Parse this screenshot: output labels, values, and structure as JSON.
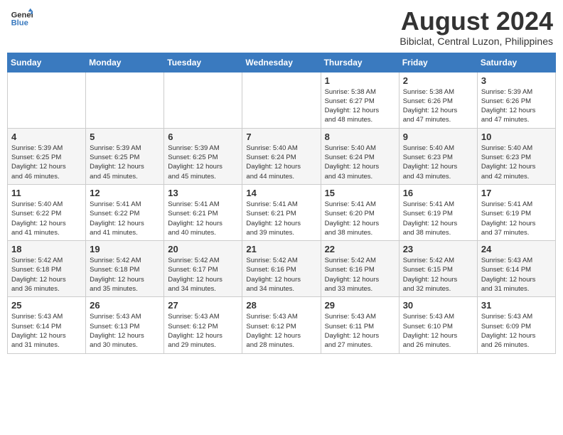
{
  "logo": {
    "line1": "General",
    "line2": "Blue"
  },
  "title": "August 2024",
  "location": "Bibiclat, Central Luzon, Philippines",
  "weekdays": [
    "Sunday",
    "Monday",
    "Tuesday",
    "Wednesday",
    "Thursday",
    "Friday",
    "Saturday"
  ],
  "weeks": [
    [
      {
        "day": "",
        "info": ""
      },
      {
        "day": "",
        "info": ""
      },
      {
        "day": "",
        "info": ""
      },
      {
        "day": "",
        "info": ""
      },
      {
        "day": "1",
        "info": "Sunrise: 5:38 AM\nSunset: 6:27 PM\nDaylight: 12 hours\nand 48 minutes."
      },
      {
        "day": "2",
        "info": "Sunrise: 5:38 AM\nSunset: 6:26 PM\nDaylight: 12 hours\nand 47 minutes."
      },
      {
        "day": "3",
        "info": "Sunrise: 5:39 AM\nSunset: 6:26 PM\nDaylight: 12 hours\nand 47 minutes."
      }
    ],
    [
      {
        "day": "4",
        "info": "Sunrise: 5:39 AM\nSunset: 6:25 PM\nDaylight: 12 hours\nand 46 minutes."
      },
      {
        "day": "5",
        "info": "Sunrise: 5:39 AM\nSunset: 6:25 PM\nDaylight: 12 hours\nand 45 minutes."
      },
      {
        "day": "6",
        "info": "Sunrise: 5:39 AM\nSunset: 6:25 PM\nDaylight: 12 hours\nand 45 minutes."
      },
      {
        "day": "7",
        "info": "Sunrise: 5:40 AM\nSunset: 6:24 PM\nDaylight: 12 hours\nand 44 minutes."
      },
      {
        "day": "8",
        "info": "Sunrise: 5:40 AM\nSunset: 6:24 PM\nDaylight: 12 hours\nand 43 minutes."
      },
      {
        "day": "9",
        "info": "Sunrise: 5:40 AM\nSunset: 6:23 PM\nDaylight: 12 hours\nand 43 minutes."
      },
      {
        "day": "10",
        "info": "Sunrise: 5:40 AM\nSunset: 6:23 PM\nDaylight: 12 hours\nand 42 minutes."
      }
    ],
    [
      {
        "day": "11",
        "info": "Sunrise: 5:40 AM\nSunset: 6:22 PM\nDaylight: 12 hours\nand 41 minutes."
      },
      {
        "day": "12",
        "info": "Sunrise: 5:41 AM\nSunset: 6:22 PM\nDaylight: 12 hours\nand 41 minutes."
      },
      {
        "day": "13",
        "info": "Sunrise: 5:41 AM\nSunset: 6:21 PM\nDaylight: 12 hours\nand 40 minutes."
      },
      {
        "day": "14",
        "info": "Sunrise: 5:41 AM\nSunset: 6:21 PM\nDaylight: 12 hours\nand 39 minutes."
      },
      {
        "day": "15",
        "info": "Sunrise: 5:41 AM\nSunset: 6:20 PM\nDaylight: 12 hours\nand 38 minutes."
      },
      {
        "day": "16",
        "info": "Sunrise: 5:41 AM\nSunset: 6:19 PM\nDaylight: 12 hours\nand 38 minutes."
      },
      {
        "day": "17",
        "info": "Sunrise: 5:41 AM\nSunset: 6:19 PM\nDaylight: 12 hours\nand 37 minutes."
      }
    ],
    [
      {
        "day": "18",
        "info": "Sunrise: 5:42 AM\nSunset: 6:18 PM\nDaylight: 12 hours\nand 36 minutes."
      },
      {
        "day": "19",
        "info": "Sunrise: 5:42 AM\nSunset: 6:18 PM\nDaylight: 12 hours\nand 35 minutes."
      },
      {
        "day": "20",
        "info": "Sunrise: 5:42 AM\nSunset: 6:17 PM\nDaylight: 12 hours\nand 34 minutes."
      },
      {
        "day": "21",
        "info": "Sunrise: 5:42 AM\nSunset: 6:16 PM\nDaylight: 12 hours\nand 34 minutes."
      },
      {
        "day": "22",
        "info": "Sunrise: 5:42 AM\nSunset: 6:16 PM\nDaylight: 12 hours\nand 33 minutes."
      },
      {
        "day": "23",
        "info": "Sunrise: 5:42 AM\nSunset: 6:15 PM\nDaylight: 12 hours\nand 32 minutes."
      },
      {
        "day": "24",
        "info": "Sunrise: 5:43 AM\nSunset: 6:14 PM\nDaylight: 12 hours\nand 31 minutes."
      }
    ],
    [
      {
        "day": "25",
        "info": "Sunrise: 5:43 AM\nSunset: 6:14 PM\nDaylight: 12 hours\nand 31 minutes."
      },
      {
        "day": "26",
        "info": "Sunrise: 5:43 AM\nSunset: 6:13 PM\nDaylight: 12 hours\nand 30 minutes."
      },
      {
        "day": "27",
        "info": "Sunrise: 5:43 AM\nSunset: 6:12 PM\nDaylight: 12 hours\nand 29 minutes."
      },
      {
        "day": "28",
        "info": "Sunrise: 5:43 AM\nSunset: 6:12 PM\nDaylight: 12 hours\nand 28 minutes."
      },
      {
        "day": "29",
        "info": "Sunrise: 5:43 AM\nSunset: 6:11 PM\nDaylight: 12 hours\nand 27 minutes."
      },
      {
        "day": "30",
        "info": "Sunrise: 5:43 AM\nSunset: 6:10 PM\nDaylight: 12 hours\nand 26 minutes."
      },
      {
        "day": "31",
        "info": "Sunrise: 5:43 AM\nSunset: 6:09 PM\nDaylight: 12 hours\nand 26 minutes."
      }
    ]
  ]
}
